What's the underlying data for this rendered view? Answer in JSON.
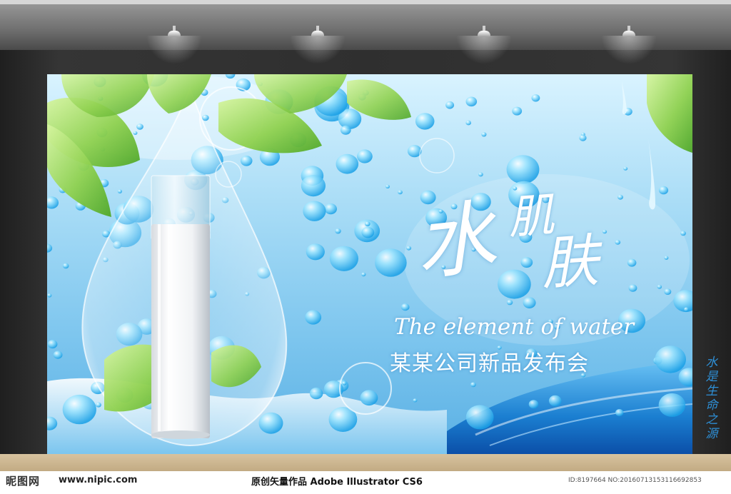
{
  "billboard": {
    "title_char_1": "水",
    "title_char_2": "肌",
    "title_char_3": "肤",
    "subtitle_en": "The element of water",
    "subtitle_cn": "某某公司新品发布会",
    "vertical_slogan": [
      "水",
      "是",
      "生",
      "命",
      "之",
      "源"
    ]
  },
  "footer": {
    "logo": "昵图网",
    "logo_url": "www.nipic.com",
    "credit": "原创矢量作品 Adobe Illustrator CS6",
    "id_text": "ID:8197664 NO:20160713153116692853"
  },
  "colors": {
    "sky_top": "#d9f3ff",
    "sky_bottom": "#5ab0e4",
    "leaf_green": "#8fd14f",
    "wall": "#2f2f2f",
    "floor": "#c9b38c",
    "slogan_blue": "#2e8fd6"
  },
  "icons": {
    "spotlight": "ceiling-spotlight-icon",
    "logo": "nipic-logo-icon"
  }
}
